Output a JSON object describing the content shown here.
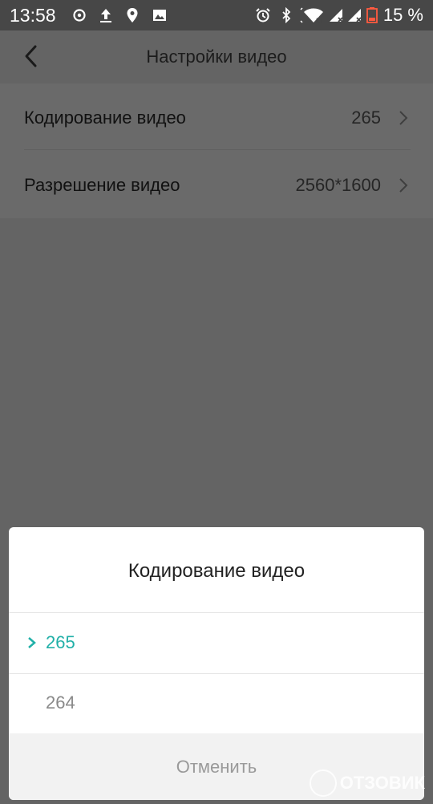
{
  "status_bar": {
    "time": "13:58",
    "battery": "15 %",
    "left_icons": [
      "settings-gear-icon",
      "upload-icon",
      "location-pin-icon",
      "image-icon"
    ],
    "right_icons": [
      "alarm-icon",
      "bluetooth-icon",
      "wifi-icon",
      "signal-icon",
      "signal-icon",
      "battery-low-icon"
    ]
  },
  "header": {
    "title": "Настройки видео"
  },
  "settings": [
    {
      "label": "Кодирование видео",
      "value": "265"
    },
    {
      "label": "Разрешение видео",
      "value": "2560*1600"
    }
  ],
  "dialog": {
    "title": "Кодирование видео",
    "options": [
      {
        "label": "265",
        "selected": true
      },
      {
        "label": "264",
        "selected": false
      }
    ],
    "cancel_label": "Отменить"
  },
  "colors": {
    "accent": "#21b0a8",
    "overlay": "#646464",
    "status_bar": "#474747"
  }
}
